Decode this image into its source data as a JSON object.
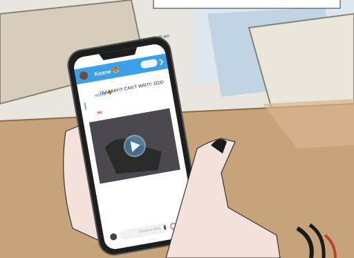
{
  "phone": {
    "status_bar": "72% ▮ 08:05 am",
    "contact_name": "Keane 🐯"
  },
  "chat": {
    "sender_label": "KEANE 🐯",
    "message_text": "YAAAAAY!!! CAN'T WAIT!! :DDD",
    "me_label": "ME",
    "input_placeholder": "Send a chat"
  },
  "colors": {
    "header_blue": "#3aa0e8",
    "me_red": "#e23a3a"
  }
}
